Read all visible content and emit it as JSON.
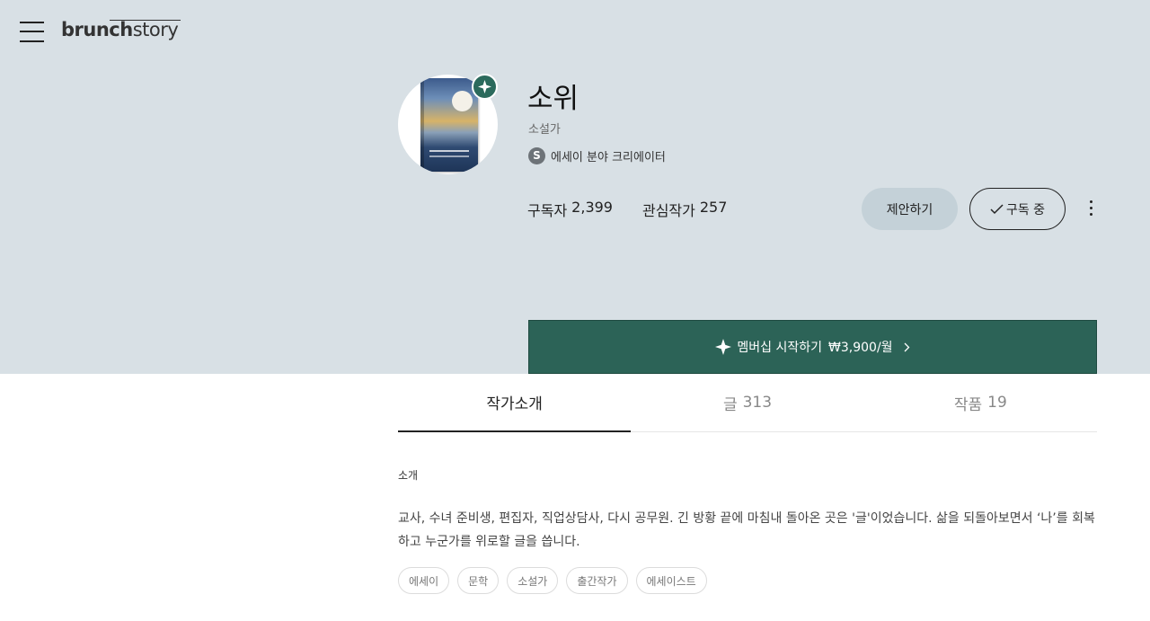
{
  "header": {
    "menu_icon": "hamburger-icon",
    "logo_part1": "brunch",
    "logo_part2": "story"
  },
  "profile": {
    "name": "소위",
    "job": "소설가",
    "creator_badge_letter": "S",
    "creator_label": "에세이 분야 크리에이터",
    "badge_icon": "diamond-sparkle-icon",
    "stats": [
      {
        "label": "구독자",
        "value": "2,399"
      },
      {
        "label": "관심작가",
        "value": "257"
      }
    ],
    "suggest_button": "제안하기",
    "subscribe_button": "구독 중",
    "more_icon": "vertical-ellipsis-icon"
  },
  "membership": {
    "label": "멤버십 시작하기",
    "price": "₩3,900/월",
    "color": "#2c6357"
  },
  "tabs": [
    {
      "label": "작가소개",
      "count": "",
      "active": true
    },
    {
      "label": "글",
      "count": "313",
      "active": false
    },
    {
      "label": "작품",
      "count": "19",
      "active": false
    }
  ],
  "intro": {
    "title": "소개",
    "text": "교사, 수녀 준비생, 편집자, 직업상담사, 다시 공무원. 긴 방황 끝에 마침내 돌아온 곳은 '글'이었습니다. 삶을 되돌아보면서 ‘나’를 회복하고 누군가를 위로할 글을 씁니다."
  },
  "tags": [
    "에세이",
    "문학",
    "소설가",
    "출간작가",
    "에세이스트"
  ],
  "colors": {
    "hero_background": "#d8e0e5",
    "accent_green": "#2c6357",
    "suggest_button_bg": "#c4d1d8"
  }
}
